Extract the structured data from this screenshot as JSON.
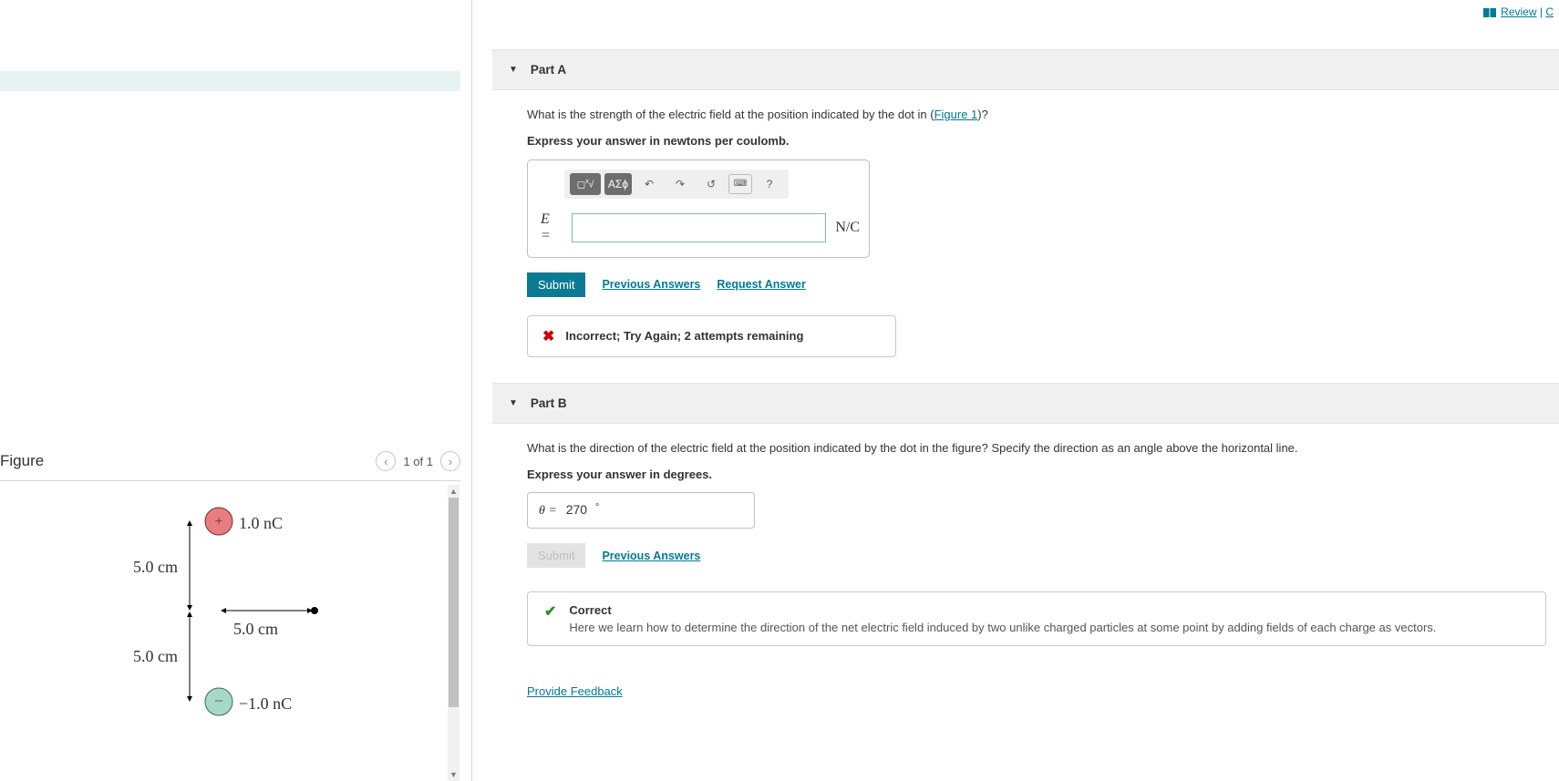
{
  "topbar": {
    "review": "Review",
    "separator": " | ",
    "trail": "C"
  },
  "figure": {
    "title": "Figure",
    "page_label": "1 of 1",
    "labels": {
      "top_dist": "5.0 cm",
      "bottom_dist": "5.0 cm",
      "horiz_dist": "5.0 cm",
      "pos_charge": "1.0 nC",
      "neg_charge": "−1.0 nC"
    }
  },
  "partA": {
    "title": "Part A",
    "question_pre": "What is the strength of the electric field at the position indicated by the dot in (",
    "figure_link": "Figure 1",
    "question_post": ")?",
    "instruction": "Express your answer in newtons per coulomb.",
    "toolbar": {
      "templates": "▢√▢",
      "greek": "ΑΣϕ",
      "undo": "↶",
      "redo": "↷",
      "reset": "↺",
      "keyboard": "⌨",
      "help": "?"
    },
    "var_label": "E =",
    "units": "N/C",
    "submit": "Submit",
    "prev_answers": "Previous Answers",
    "request_answer": "Request Answer",
    "feedback": "Incorrect; Try Again; 2 attempts remaining"
  },
  "partB": {
    "title": "Part B",
    "question": "What is the direction of the electric field at the position indicated by the dot in the figure? Specify the direction as an angle above the horizontal line.",
    "instruction": "Express your answer in degrees.",
    "var_label": "θ =",
    "value": "270",
    "unit": "∘",
    "submit": "Submit",
    "prev_answers": "Previous Answers",
    "correct_title": "Correct",
    "correct_body": "Here we learn how to determine the direction of the net electric field induced by two unlike charged particles at some point by adding fields of each charge as vectors."
  },
  "provide_feedback": "Provide Feedback"
}
